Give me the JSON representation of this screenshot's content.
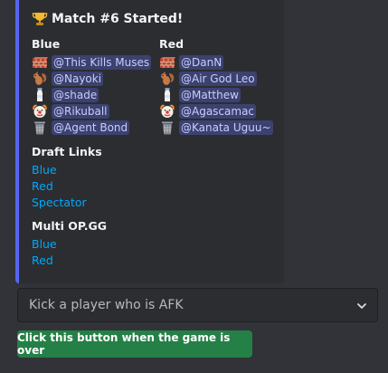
{
  "embed": {
    "title": "Match #6 Started!",
    "title_icon": "trophy-icon",
    "accent_color": "#5865f2",
    "teams": [
      {
        "name": "Blue",
        "players": [
          {
            "icon": "brick-icon",
            "mention": "@This Kills Muses"
          },
          {
            "icon": "squirrel-icon",
            "mention": "@Nayoki"
          },
          {
            "icon": "milk-bottle-icon",
            "mention": "@shade"
          },
          {
            "icon": "clown-face-icon",
            "mention": "@Rikuball"
          },
          {
            "icon": "wastebasket-icon",
            "mention": "@Agent Bond"
          }
        ]
      },
      {
        "name": "Red",
        "players": [
          {
            "icon": "brick-icon",
            "mention": "@DanN"
          },
          {
            "icon": "squirrel-icon",
            "mention": "@Air God Leo"
          },
          {
            "icon": "milk-bottle-icon",
            "mention": "@Matthew"
          },
          {
            "icon": "clown-face-icon",
            "mention": "@Agascamac"
          },
          {
            "icon": "wastebasket-icon",
            "mention": "@Kanata Uguu~"
          }
        ]
      }
    ],
    "draft_links": {
      "title": "Draft Links",
      "links": [
        "Blue",
        "Red",
        "Spectator"
      ]
    },
    "multi_opgg": {
      "title": "Multi OP.GG",
      "links": [
        "Blue",
        "Red"
      ]
    }
  },
  "select": {
    "placeholder": "Kick a player who is AFK",
    "icon": "chevron-down-icon"
  },
  "button": {
    "label": "Click this button when the game is over",
    "color": "#248046"
  }
}
